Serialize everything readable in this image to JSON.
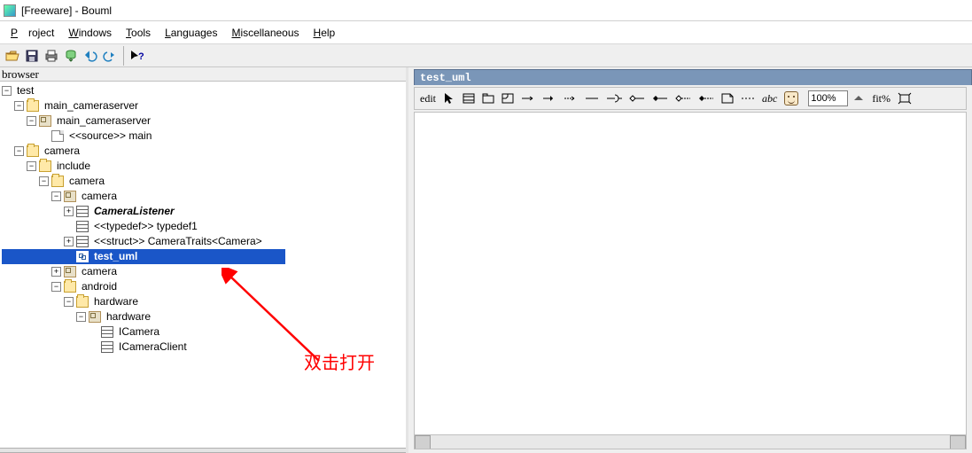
{
  "title": "[Freeware] - Bouml",
  "menus": {
    "project": "Project",
    "windows": "Windows",
    "tools": "Tools",
    "languages": "Languages",
    "misc": "Miscellaneous",
    "help": "Help"
  },
  "browser_label": "browser",
  "tree": {
    "root": "test",
    "main_cameraserver": "main_cameraserver",
    "main_cameraserver_comp": "main_cameraserver",
    "source_main": "<<source>> main",
    "camera": "camera",
    "include": "include",
    "camera2": "camera",
    "camera_class": "camera",
    "camera_listener": "CameraListener",
    "typedef1": "<<typedef>> typedef1",
    "struct_traits": "<<struct>> CameraTraits<Camera>",
    "test_uml": "test_uml",
    "camera3": "camera",
    "android": "android",
    "hardware": "hardware",
    "hardware_comp": "hardware",
    "icamera": "ICamera",
    "icamera_client": "ICameraClient"
  },
  "diagram": {
    "tab_title": "test_uml",
    "edit_label": "edit",
    "zoom": "100%",
    "fit_label": "fit%",
    "abc_label": "abc"
  },
  "annotation": {
    "text": "双击打开"
  }
}
